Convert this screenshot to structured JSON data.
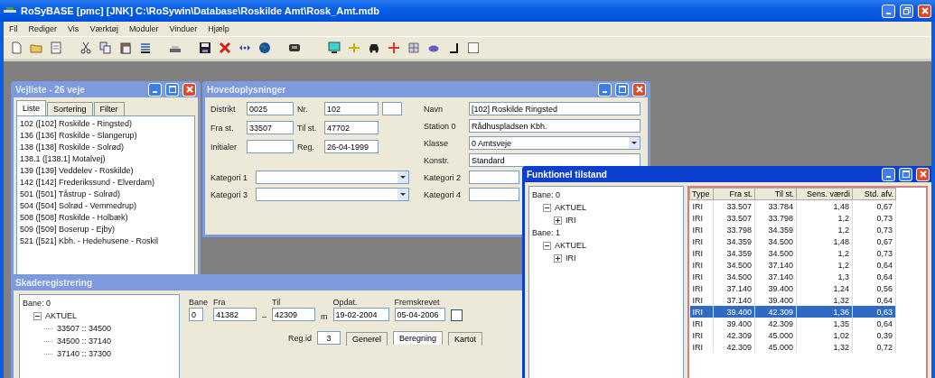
{
  "app": {
    "title": "RoSyBASE [pmc] [JNK] C:\\RoSywin\\Database\\Roskilde Amt\\Rosk_Amt.mdb",
    "menu": [
      "Fil",
      "Rediger",
      "Vis",
      "Værktøj",
      "Moduler",
      "Vinduer",
      "Hjælp"
    ]
  },
  "road_list": {
    "title": "Vejliste - 26 veje",
    "active": false,
    "tabs": [
      {
        "label": "Liste",
        "selected": true
      },
      {
        "label": "Sortering",
        "selected": false
      },
      {
        "label": "Filter",
        "selected": false
      }
    ],
    "items": [
      {
        "label": "102 ([102] Roskilde - Ringsted)",
        "selected": false
      },
      {
        "label": "136 ([136] Roskilde - Slangerup)",
        "selected": false
      },
      {
        "label": "138 ([138] Roskilde - Solrød)",
        "selected": false
      },
      {
        "label": "138.1 ([138.1] Motalvej)",
        "selected": false
      },
      {
        "label": "139 ([139] Veddelev - Roskilde)",
        "selected": false
      },
      {
        "label": "142 ([142] Frederikssund - Elverdam)",
        "selected": false
      },
      {
        "label": "501 ([501] Tåstrup - Solrød)",
        "selected": false
      },
      {
        "label": "504 ([504] Solrød - Vemmedrup)",
        "selected": false
      },
      {
        "label": "508 ([508] Roskilde - Holbæk)",
        "selected": false
      },
      {
        "label": "509 ([509] Boserup - Ejby)",
        "selected": false
      },
      {
        "label": "521 ([521] Kbh. - Hedehusene - Roskil",
        "selected": false
      }
    ]
  },
  "main_info": {
    "title": "Hovedoplysninger",
    "active": false,
    "left_rows": [
      [
        {
          "label": "Distrikt",
          "value": "0025"
        },
        {
          "label": "Nr.",
          "value": "102"
        }
      ],
      [
        {
          "label": "Fra st.",
          "value": "33507"
        },
        {
          "label": "Til st.",
          "value": "47702"
        }
      ],
      [
        {
          "label": "Initialer"
        },
        {
          "label": "Reg.",
          "value": "26-04-1999"
        }
      ]
    ],
    "right_rows": [
      {
        "label": "Navn",
        "value": "[102] Roskilde  Ringsted",
        "kind": "text"
      },
      {
        "label": "Station 0",
        "value": "Rådhuspladsen Kbh.",
        "kind": "text"
      },
      {
        "label": "Klasse",
        "value": "0 Amtsveje",
        "kind": "select"
      },
      {
        "label": "Konstr.",
        "value": "Standard",
        "kind": "text"
      }
    ],
    "categories": [
      [
        {
          "label": "Kategori 1",
          "kind": "select"
        },
        {
          "label": "Kategori 2",
          "kind": "text"
        }
      ],
      [
        {
          "label": "Kategori 3",
          "kind": "select"
        },
        {
          "label": "Kategori 4",
          "kind": "text"
        }
      ]
    ]
  },
  "segments": {
    "title": "Skaderegistrering",
    "active": false,
    "tree": [
      {
        "label": "Bane: 0",
        "children": [
          {
            "label": "AKTUEL",
            "expanded": true,
            "children": [
              {
                "label": "33507 :: 34500"
              },
              {
                "label": "34500 :: 37140"
              },
              {
                "label": "37140 :: 37300"
              }
            ]
          }
        ]
      }
    ],
    "fields": [
      {
        "label": "Bane",
        "value": "0"
      },
      {
        "label": "Fra",
        "value": "41382"
      },
      {
        "label": "Til",
        "value": "42309"
      },
      {
        "label": "Opdat.",
        "value": "19-02-2004"
      },
      {
        "label": "Fremskrevet",
        "value": "05-04-2006"
      }
    ],
    "range_dash": "–",
    "unit": "m",
    "checked": false,
    "reg_label": "Reg.id",
    "reg_value": "3",
    "tabs": [
      {
        "label": "Generel",
        "selected": false
      },
      {
        "label": "Beregning",
        "selected": true
      },
      {
        "label": "Kartot",
        "selected": false
      }
    ]
  },
  "functional_state": {
    "title": "Funktionel tilstand",
    "active": true,
    "tree": [
      {
        "label": "Bane: 0",
        "children": [
          {
            "label": "AKTUEL",
            "expanded": true,
            "children": [
              {
                "label": "IRI",
                "expanded": false
              }
            ]
          }
        ]
      },
      {
        "label": "Bane: 1",
        "children": [
          {
            "label": "AKTUEL",
            "expanded": true,
            "children": [
              {
                "label": "IRI",
                "expanded": false
              }
            ]
          }
        ]
      }
    ],
    "columns": [
      "Type",
      "Fra st.",
      "Til st.",
      "Sens. værdi",
      "Std. afv."
    ],
    "rows": [
      {
        "cells": [
          "IRI",
          "33.507",
          "33.784",
          "1,48",
          "0,67"
        ],
        "selected": false
      },
      {
        "cells": [
          "IRI",
          "33.507",
          "33.798",
          "1,2",
          "0,73"
        ],
        "selected": false
      },
      {
        "cells": [
          "IRI",
          "33.798",
          "34.359",
          "1,2",
          "0,73"
        ],
        "selected": false
      },
      {
        "cells": [
          "IRI",
          "34.359",
          "34.500",
          "1,48",
          "0,67"
        ],
        "selected": false
      },
      {
        "cells": [
          "IRI",
          "34.359",
          "34.500",
          "1,2",
          "0,73"
        ],
        "selected": false
      },
      {
        "cells": [
          "IRI",
          "34.500",
          "37.140",
          "1,2",
          "0,64"
        ],
        "selected": false
      },
      {
        "cells": [
          "IRI",
          "34.500",
          "37.140",
          "1,3",
          "0,64"
        ],
        "selected": false
      },
      {
        "cells": [
          "IRI",
          "37.140",
          "39.400",
          "1,24",
          "0,56"
        ],
        "selected": false
      },
      {
        "cells": [
          "IRI",
          "37.140",
          "39.400",
          "1,32",
          "0,64"
        ],
        "selected": false
      },
      {
        "cells": [
          "IRI",
          "39.400",
          "42.309",
          "1,36",
          "0,63"
        ],
        "selected": true
      },
      {
        "cells": [
          "IRI",
          "39.400",
          "42.309",
          "1,35",
          "0,64"
        ],
        "selected": false
      },
      {
        "cells": [
          "IRI",
          "42.309",
          "45.000",
          "1,02",
          "0,39"
        ],
        "selected": false
      },
      {
        "cells": [
          "IRI",
          "42.309",
          "45.000",
          "1,32",
          "0,72"
        ],
        "selected": false
      }
    ]
  }
}
